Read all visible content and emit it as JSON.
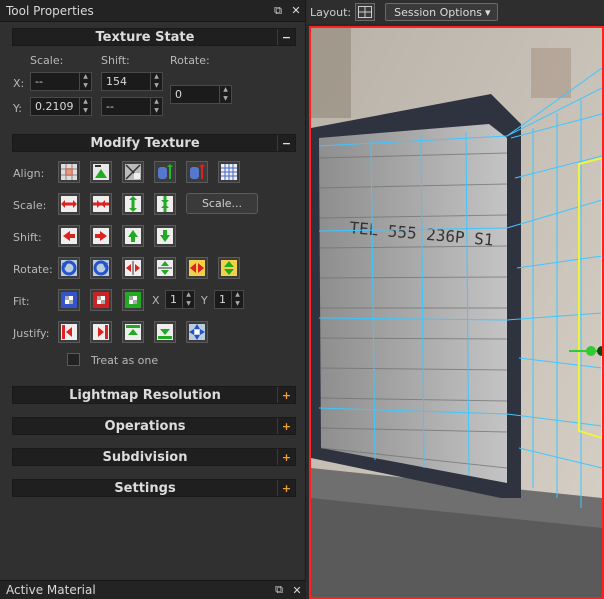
{
  "tool_properties": {
    "title": "Tool Properties",
    "restore_glyph": "⧉",
    "close_glyph": "✕"
  },
  "texture_state": {
    "title": "Texture State",
    "toggle": "−",
    "scale_label": "Scale:",
    "shift_label": "Shift:",
    "rotate_label": "Rotate:",
    "x_label": "X:",
    "y_label": "Y:",
    "scale_x": "--",
    "scale_y": "0.2109",
    "shift_x": "154",
    "shift_y": "--",
    "rotate": "0"
  },
  "modify_texture": {
    "title": "Modify Texture",
    "toggle": "−",
    "align_label": "Align:",
    "scale_label": "Scale:",
    "scale_button": "Scale...",
    "shift_label": "Shift:",
    "rotate_label": "Rotate:",
    "fit_label": "Fit:",
    "fit_x_label": "X",
    "fit_y_label": "Y",
    "fit_x": "1",
    "fit_y": "1",
    "justify_label": "Justify:",
    "treat_as_one": "Treat as one",
    "treat_as_one_checked": false,
    "icons": {
      "align": [
        "align-world-icon",
        "align-face-icon",
        "align-view-icon",
        "align-cylinder-u-icon",
        "align-cylinder-v-icon",
        "align-grid-icon"
      ],
      "scale": [
        "scale-horizontal-up-icon",
        "scale-horizontal-down-icon",
        "scale-vertical-up-icon",
        "scale-vertical-down-icon"
      ],
      "shift": [
        "shift-left-icon",
        "shift-right-icon",
        "shift-up-icon",
        "shift-down-icon"
      ],
      "rotate": [
        "rotate-ccw-icon",
        "rotate-cw-icon",
        "flip-horizontal-icon",
        "flip-vertical-icon",
        "mirror-horizontal-icon",
        "mirror-vertical-icon"
      ],
      "fit": [
        "fit-both-icon",
        "fit-width-icon",
        "fit-height-icon"
      ],
      "justify": [
        "justify-left-icon",
        "justify-right-icon",
        "justify-top-icon",
        "justify-bottom-icon",
        "justify-center-icon"
      ]
    }
  },
  "collapsed_sections": [
    {
      "title": "Lightmap Resolution",
      "toggle": "+"
    },
    {
      "title": "Operations",
      "toggle": "+"
    },
    {
      "title": "Subdivision",
      "toggle": "+"
    },
    {
      "title": "Settings",
      "toggle": "+"
    }
  ],
  "active_material": {
    "title": "Active Material",
    "restore_glyph": "⧉",
    "close_glyph": "✕"
  },
  "viewport": {
    "layout_label": "Layout:",
    "session_options": "Session Options",
    "sign_text": "TEL 555 236P  S1",
    "selection_color": "#ff2020",
    "grid_color": "#3fc6ff",
    "face_highlight_color": "#f2f23a",
    "gizmo_color": "#2ecc2e"
  },
  "colors": {
    "panel_bg": "#303030",
    "header_bg": "#1f1f1f",
    "plus_color": "#f0a030"
  }
}
